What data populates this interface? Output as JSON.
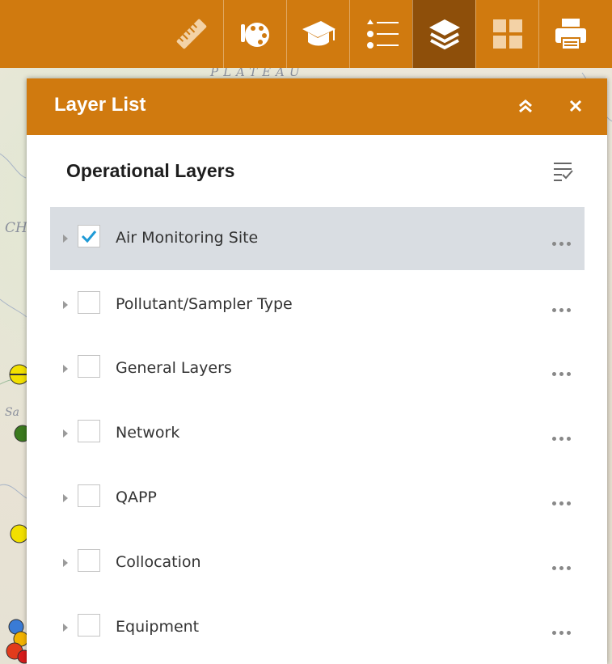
{
  "toolbar": {
    "items": [
      {
        "name": "measure",
        "icon": "ruler-icon"
      },
      {
        "name": "basemap",
        "icon": "palette-icon"
      },
      {
        "name": "about",
        "icon": "graduation-cap-icon"
      },
      {
        "name": "legend",
        "icon": "list-icon"
      },
      {
        "name": "layer-list",
        "icon": "layers-icon",
        "active": true
      },
      {
        "name": "basemap-gallery",
        "icon": "grid-icon"
      },
      {
        "name": "print",
        "icon": "printer-icon"
      }
    ],
    "accent_color": "#d07a0f",
    "active_color": "#8e4f0a"
  },
  "panel": {
    "title": "Layer List",
    "collapse_icon": "double-chevron-up-icon",
    "close_icon": "close-icon",
    "section_title": "Operational Layers",
    "filter_icon": "filter-list-icon",
    "layers": [
      {
        "label": "Air Monitoring Site",
        "checked": true,
        "selected": true
      },
      {
        "label": "Pollutant/Sampler Type",
        "checked": false,
        "selected": false
      },
      {
        "label": "General Layers",
        "checked": false,
        "selected": false
      },
      {
        "label": "Network",
        "checked": false,
        "selected": false
      },
      {
        "label": "QAPP",
        "checked": false,
        "selected": false
      },
      {
        "label": "Collocation",
        "checked": false,
        "selected": false
      },
      {
        "label": "Equipment",
        "checked": false,
        "selected": false
      }
    ]
  },
  "map": {
    "labels": [
      "PLATEAU",
      "CH",
      "Sa"
    ]
  }
}
